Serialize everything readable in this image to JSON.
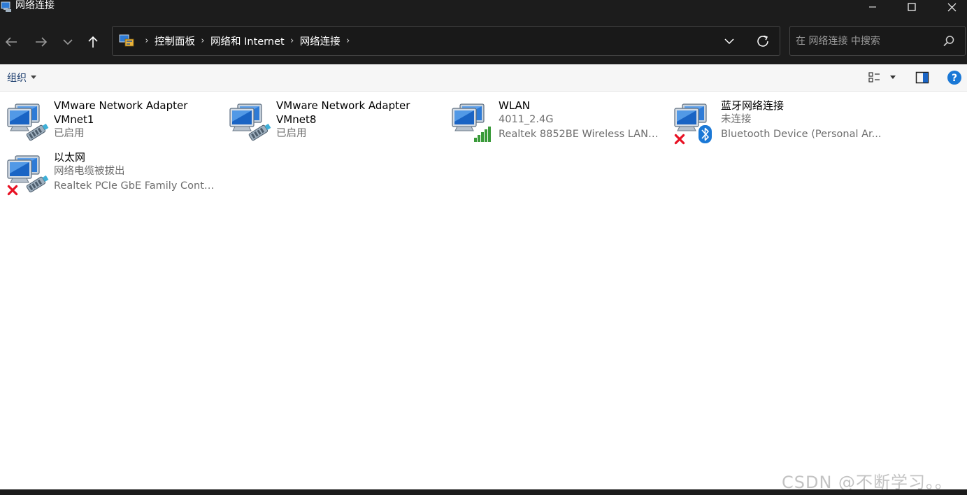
{
  "window": {
    "title": "网络连接",
    "minimize_icon": "minimize-icon",
    "maximize_icon": "maximize-icon",
    "close_icon": "close-icon"
  },
  "nav": {
    "icons": [
      "back-arrow-icon",
      "forward-arrow-icon",
      "recent-chevron-icon",
      "up-arrow-icon"
    ],
    "breadcrumbs": [
      "控制面板",
      "网络和 Internet",
      "网络连接"
    ],
    "search_placeholder": "在 网络连接 中搜索"
  },
  "commandbar": {
    "organize_label": "组织"
  },
  "connections": [
    {
      "name": "VMware Network Adapter VMnet1",
      "line1": "VMware Network Adapter",
      "line2": "VMnet1",
      "status": "已启用",
      "icon": "network-adapter-icon"
    },
    {
      "name": "VMware Network Adapter VMnet8",
      "line1": "VMware Network Adapter",
      "line2": "VMnet8",
      "status": "已启用",
      "icon": "network-adapter-icon"
    },
    {
      "name": "WLAN",
      "line1": "WLAN",
      "status": "4011_2.4G",
      "device": "Realtek 8852BE Wireless LAN ...",
      "icon": "wireless-signal-icon"
    },
    {
      "name": "蓝牙网络连接",
      "line1": "蓝牙网络连接",
      "status": "未连接",
      "device": "Bluetooth Device (Personal Ar...",
      "icon": "bluetooth-icon"
    },
    {
      "name": "以太网",
      "line1": "以太网",
      "status": "网络电缆被拔出",
      "device": "Realtek PCIe GbE Family Contr...",
      "icon": "ethernet-disconnected-icon"
    }
  ],
  "watermark": "CSDN @不断学习。。",
  "colors": {
    "titlebar_bg": "#1c1c1c",
    "commandbar_bg": "#f6f6f6",
    "accent_blue": "#0078d4",
    "disconnected_red": "#e81123",
    "signal_green": "#3a9a3a"
  }
}
